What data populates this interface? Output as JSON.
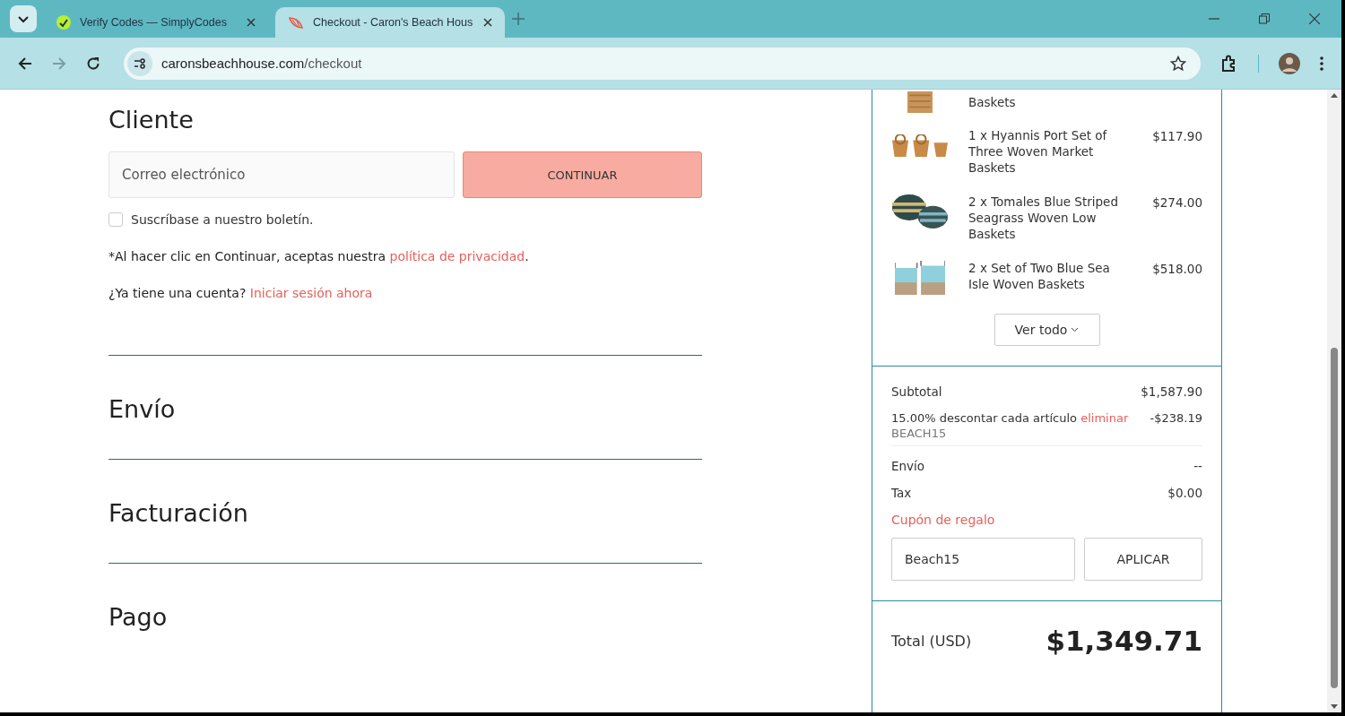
{
  "browser": {
    "tabs": [
      {
        "title": "Verify Codes — SimplyCodes",
        "selected": false
      },
      {
        "title": "Checkout - Caron's Beach Hous",
        "selected": true
      }
    ],
    "address": {
      "domain": "caronsbeachhouse.com",
      "path": "/checkout"
    }
  },
  "customer": {
    "heading": "Cliente",
    "email_placeholder": "Correo electrónico",
    "continue_button": "CONTINUAR",
    "newsletter": {
      "label": "Suscríbase a nuestro boletín.",
      "checked": false
    },
    "privacy": {
      "text": "*Al hacer clic en Continuar, aceptas nuestra ",
      "link": "política de privacidad",
      "after": "."
    },
    "account": {
      "text": "¿Ya tiene una cuenta? ",
      "link": "Iniciar sesión ahora"
    }
  },
  "steps": [
    {
      "heading": "Envío"
    },
    {
      "heading": "Facturación"
    },
    {
      "heading": "Pago"
    }
  ],
  "summary": {
    "partial_item": {
      "text": "Baskets"
    },
    "items": [
      {
        "text": "1 x Hyannis Port Set of Three Woven Market Baskets",
        "price": "$117.90"
      },
      {
        "text": "2 x Tomales Blue Striped Seagrass Woven Low Baskets",
        "price": "$274.00"
      },
      {
        "text": "2 x Set of Two Blue Sea Isle Woven Baskets",
        "price": "$518.00"
      }
    ],
    "view_all": "Ver todo",
    "subtotal": {
      "label": "Subtotal",
      "value": "$1,587.90"
    },
    "discount": {
      "label": "15.00% descontar cada artículo ",
      "link": "eliminar",
      "value": "-$238.19",
      "code": "BEACH15"
    },
    "shipping": {
      "label": "Envío",
      "value": "--"
    },
    "tax": {
      "label": "Tax",
      "value": "$0.00"
    },
    "gift_coupon": "Cupón de regalo",
    "coupon_value": "Beach15",
    "apply_button": "APLICAR",
    "total": {
      "label": "Total (USD)",
      "value": "$1,349.71"
    }
  }
}
